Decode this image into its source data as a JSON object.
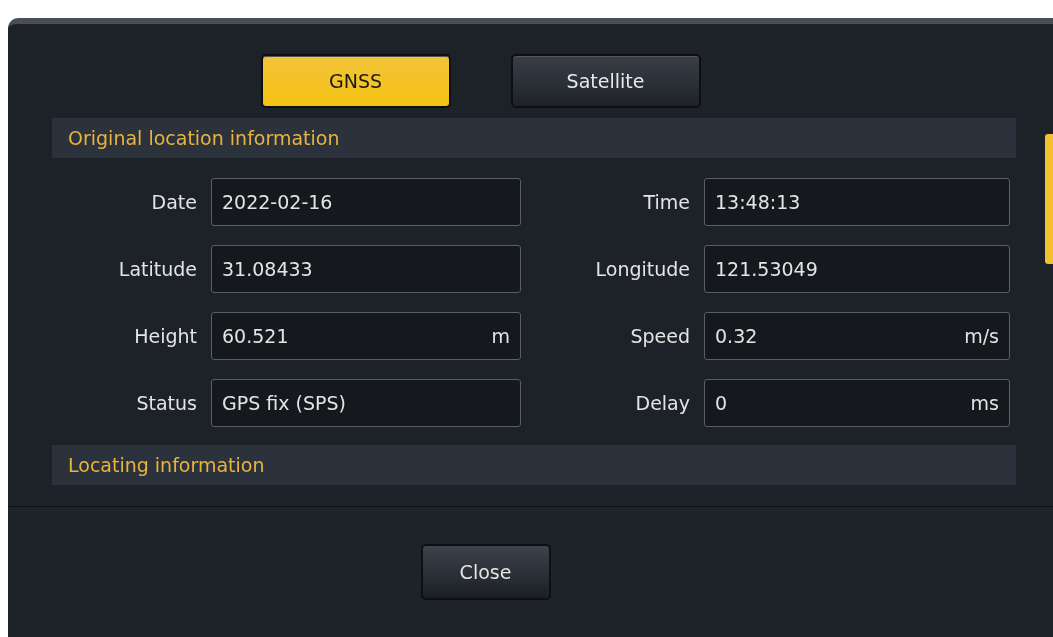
{
  "tabs": [
    {
      "label": "GNSS",
      "selected": true
    },
    {
      "label": "Satellite",
      "selected": false
    }
  ],
  "sections": [
    {
      "title": "Original location information",
      "rows": [
        [
          {
            "label": "Date",
            "value": "2022-02-16"
          },
          {
            "label": "Time",
            "value": "13:48:13"
          }
        ],
        [
          {
            "label": "Latitude",
            "value": "31.08433"
          },
          {
            "label": "Longitude",
            "value": "121.53049"
          }
        ],
        [
          {
            "label": "Height",
            "value": "60.521",
            "unit": "m"
          },
          {
            "label": "Speed",
            "value": "0.32",
            "unit": "m/s"
          }
        ],
        [
          {
            "label": "Status",
            "value": "GPS fix (SPS)"
          },
          {
            "label": "Delay",
            "value": "0",
            "unit": "ms"
          }
        ]
      ]
    },
    {
      "title": "Locating information"
    }
  ],
  "buttons": [
    "Close"
  ]
}
